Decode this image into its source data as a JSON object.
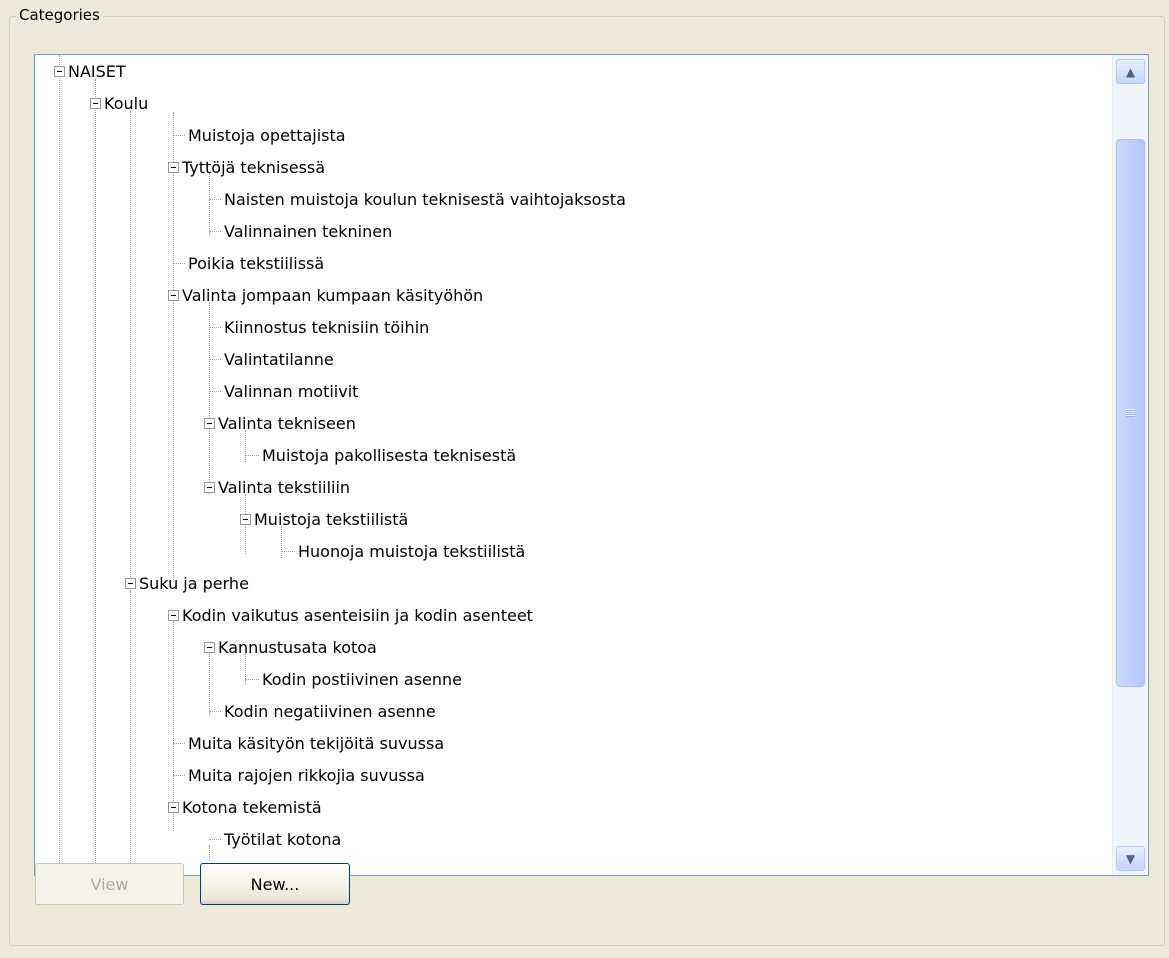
{
  "groupbox": {
    "title": "Categories"
  },
  "tree": {
    "nodes": [
      {
        "label": "NAISET",
        "expanded": true
      },
      {
        "label": "Koulu",
        "expanded": true
      },
      {
        "label": "Muistoja opettajista"
      },
      {
        "label": "Tyttöjä teknisessä",
        "expanded": true
      },
      {
        "label": "Naisten muistoja koulun teknisestä vaihtojaksosta"
      },
      {
        "label": "Valinnainen tekninen"
      },
      {
        "label": "Poikia tekstiilissä"
      },
      {
        "label": "Valinta jompaan kumpaan käsityöhön",
        "expanded": true
      },
      {
        "label": "Kiinnostus teknisiin töihin"
      },
      {
        "label": "Valintatilanne"
      },
      {
        "label": "Valinnan motiivit"
      },
      {
        "label": "Valinta tekniseen",
        "expanded": true
      },
      {
        "label": "Muistoja pakollisesta teknisestä"
      },
      {
        "label": "Valinta tekstiiliin",
        "expanded": true
      },
      {
        "label": "Muistoja tekstiilistä",
        "expanded": true
      },
      {
        "label": "Huonoja muistoja tekstiilistä"
      },
      {
        "label": "Suku ja perhe",
        "expanded": true
      },
      {
        "label": "Kodin vaikutus asenteisiin ja kodin asenteet",
        "expanded": true
      },
      {
        "label": "Kannustusata kotoa",
        "expanded": true
      },
      {
        "label": "Kodin postiivinen asenne"
      },
      {
        "label": "Kodin negatiivinen asenne"
      },
      {
        "label": "Muita käsityön tekijöitä suvussa"
      },
      {
        "label": "Muita rajojen rikkojia suvussa"
      },
      {
        "label": "Kotona tekemistä",
        "expanded": true
      },
      {
        "label": "Työtilat kotona"
      }
    ]
  },
  "scrollbar": {
    "position": 0.35,
    "visible_fraction": 0.7
  },
  "buttons": {
    "view": "View",
    "new": "New..."
  }
}
